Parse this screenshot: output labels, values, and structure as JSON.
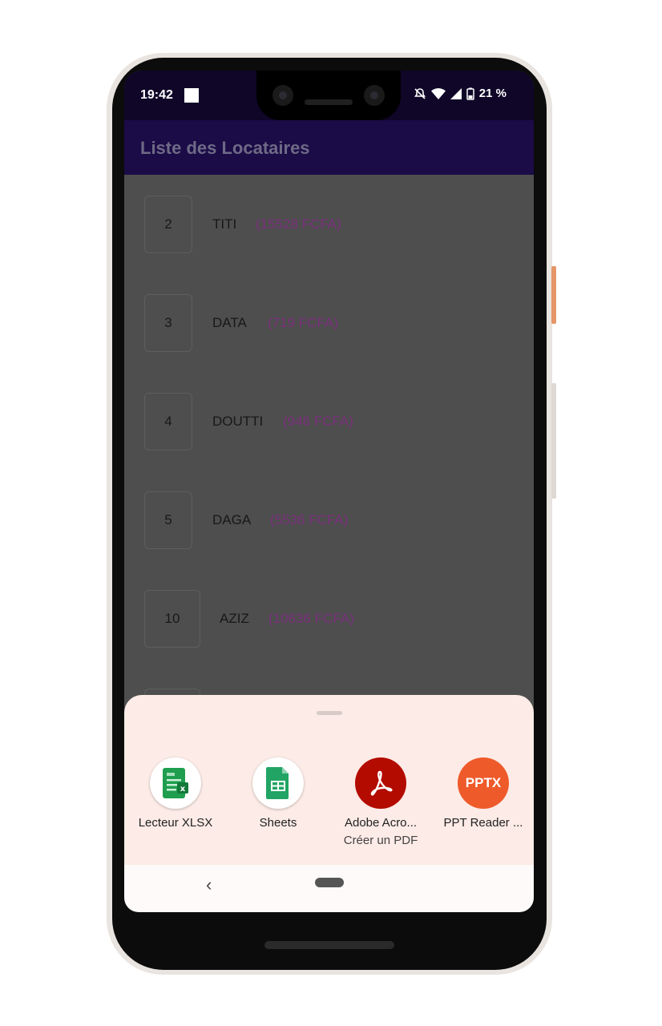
{
  "status_bar": {
    "time": "19:42",
    "battery_text": "21 %"
  },
  "app_bar": {
    "title": "Liste des Locataires"
  },
  "tenants": [
    {
      "id": "2",
      "name": "TITI",
      "amount": "(15528 FCFA)"
    },
    {
      "id": "3",
      "name": "DATA",
      "amount": "(719 FCFA)"
    },
    {
      "id": "4",
      "name": "DOUTTI",
      "amount": "(946 FCFA)"
    },
    {
      "id": "5",
      "name": "DAGA",
      "amount": "(5536 FCFA)"
    },
    {
      "id": "10",
      "name": "AZIZ",
      "amount": "(10636 FCFA)"
    }
  ],
  "share_sheet": {
    "apps": [
      {
        "name": "Lecteur XLSX",
        "icon": "xlsx-reader-icon"
      },
      {
        "name": "Sheets",
        "icon": "google-sheets-icon"
      },
      {
        "name": "Adobe Acro...",
        "subtitle": "Créer un PDF",
        "icon": "adobe-acrobat-icon"
      },
      {
        "name": "PPT Reader ...",
        "icon": "pptx-reader-icon",
        "icon_text": "PPTX"
      }
    ]
  },
  "colors": {
    "status_bar": "#0f0628",
    "app_bar": "#1b0b47",
    "amount_text": "#7b2f7d",
    "sheet_bg": "#fcebe6"
  }
}
